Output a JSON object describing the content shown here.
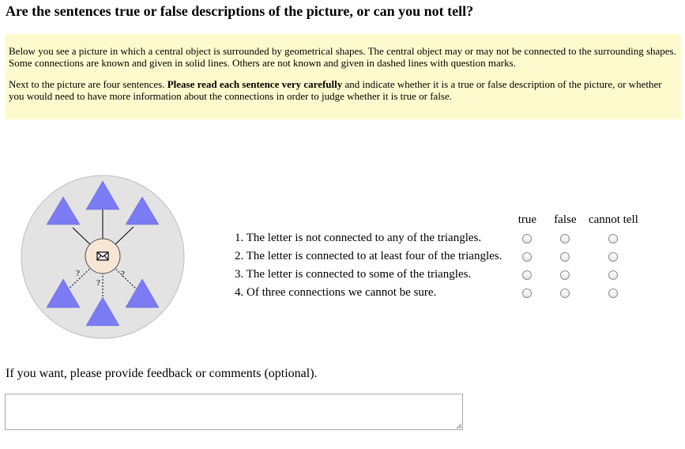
{
  "title": "Are the sentences true or false descriptions of the picture, or can you not tell?",
  "instructions": {
    "para1": "Below you see a picture in which a central object is surrounded by geometrical shapes. The central object may or may not be connected to the surrounding shapes. Some connections are known and given in solid lines. Others are not known and given in dashed lines with question marks.",
    "para2_before": "Next to the picture are four sentences. ",
    "para2_bold": "Please read each sentence very carefully",
    "para2_after": " and indicate whether it is a true or false description of the picture, or whether you would need to have more information about the connections in order to judge whether it is true or false."
  },
  "figure": {
    "center_icon": "envelope-icon",
    "question_mark": "?",
    "colors": {
      "circle": "#e3e3e3",
      "triangle": "#7b7cf4",
      "center": "#f7e6d3"
    }
  },
  "columns": {
    "true": "true",
    "false": "false",
    "cannot_tell": "cannot tell"
  },
  "sentences": [
    "1. The letter is not connected to any of the triangles.",
    "2. The letter is connected to at least four of the triangles.",
    "3. The letter is connected to some of the triangles.",
    "4. Of three connections we cannot be sure."
  ],
  "feedback": {
    "label": "If you want, please provide feedback or comments (optional).",
    "value": ""
  }
}
